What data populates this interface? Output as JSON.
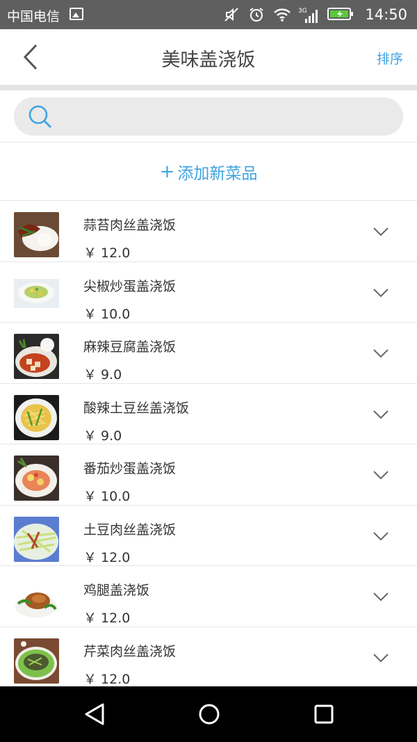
{
  "status_bar": {
    "carrier": "中国电信",
    "time": "14:50",
    "network": "3G",
    "icons": [
      "image-icon",
      "mute-icon",
      "alarm-icon",
      "wifi-icon",
      "signal-icon",
      "battery-charging-icon"
    ]
  },
  "header": {
    "title": "美味盖浇饭",
    "sort_label": "排序"
  },
  "search": {
    "placeholder": ""
  },
  "add_new": {
    "plus": "+",
    "label": "添加新菜品"
  },
  "currency": "￥",
  "items": [
    {
      "name": "蒜苔肉丝盖浇饭",
      "price": "￥ 12.0"
    },
    {
      "name": "尖椒炒蛋盖浇饭",
      "price": "￥ 10.0"
    },
    {
      "name": "麻辣豆腐盖浇饭",
      "price": "￥ 9.0"
    },
    {
      "name": "酸辣土豆丝盖浇饭",
      "price": "￥ 9.0"
    },
    {
      "name": "番茄炒蛋盖浇饭",
      "price": "￥ 10.0"
    },
    {
      "name": "土豆肉丝盖浇饭",
      "price": "￥ 12.0"
    },
    {
      "name": "鸡腿盖浇饭",
      "price": "￥ 12.0"
    },
    {
      "name": "芹菜肉丝盖浇饭",
      "price": "￥ 12.0"
    }
  ],
  "colors": {
    "accent": "#3ea2e0",
    "status_bar": "#5f5f5f",
    "nav_bar": "#000000"
  }
}
